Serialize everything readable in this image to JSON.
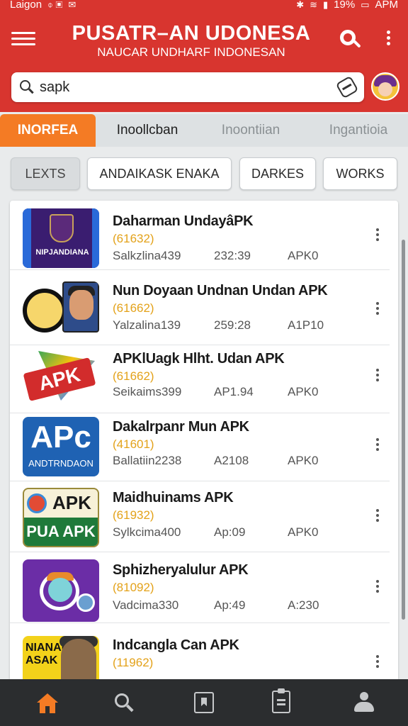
{
  "status_bar": {
    "carrier": "Laigon",
    "battery": "19%",
    "time": "APM"
  },
  "header": {
    "title": "PUSATR–AN UDONESA",
    "subtitle": "NAUCAR UNDHARF INDONESAN"
  },
  "search": {
    "value": "sapk"
  },
  "tabs": [
    {
      "label": "INORFEA"
    },
    {
      "label": "Inoollcban"
    },
    {
      "label": "Inoontiian"
    },
    {
      "label": "Ingantioia"
    }
  ],
  "chips": [
    {
      "label": "LEXTS"
    },
    {
      "label": "ANDAIKASK ENAKA"
    },
    {
      "label": "DARKES"
    },
    {
      "label": "WORKS"
    }
  ],
  "apps": [
    {
      "name": "Daharman UndayâPK",
      "code": "(61632)",
      "meta1": "Salkzlina439",
      "meta2": "232:39",
      "meta3": "APK0",
      "icon_text": "NIPJANDIANA"
    },
    {
      "name": "Nun Doyaan Undnan Undan APK",
      "code": "(61662)",
      "meta1": "Yalzalina139",
      "meta2": "259:28",
      "meta3": "A1P10",
      "icon_text": ""
    },
    {
      "name": "APKlUagk Hlht. Udan APK",
      "code": "(61662)",
      "meta1": "Seikaims399",
      "meta2": "AP1.94",
      "meta3": "APK0",
      "icon_text": "APK"
    },
    {
      "name": "Dakalrpanr Mun APK",
      "code": "(41601)",
      "meta1": "Ballatiin2238",
      "meta2": "A2108",
      "meta3": "APK0",
      "icon_text": "APc",
      "icon_sub": "ANDTRNDAON"
    },
    {
      "name": "Maidhuinams APK",
      "code": "(61932)",
      "meta1": "Sylkcima400",
      "meta2": "Ap:09",
      "meta3": "APK0",
      "icon_text": "APK",
      "icon_sub": "PUA APK"
    },
    {
      "name": "Sphizheryalulur APK",
      "code": "(81092)",
      "meta1": "Vadcima330",
      "meta2": "Ap:49",
      "meta3": "A:230",
      "icon_text": ""
    },
    {
      "name": "Indcangla Can APK",
      "code": "(11962)",
      "meta1": "",
      "meta2": "",
      "meta3": "",
      "icon_text": "NIANAB ASAK"
    }
  ],
  "colors": {
    "header_red": "#d8352f",
    "accent_orange": "#f47b24",
    "code_yellow": "#e3a21a",
    "nav_dark": "#2b2d2f"
  },
  "bottom_nav": [
    "home-icon",
    "search-icon",
    "bookmark-icon",
    "clipboard-icon",
    "user-icon"
  ]
}
